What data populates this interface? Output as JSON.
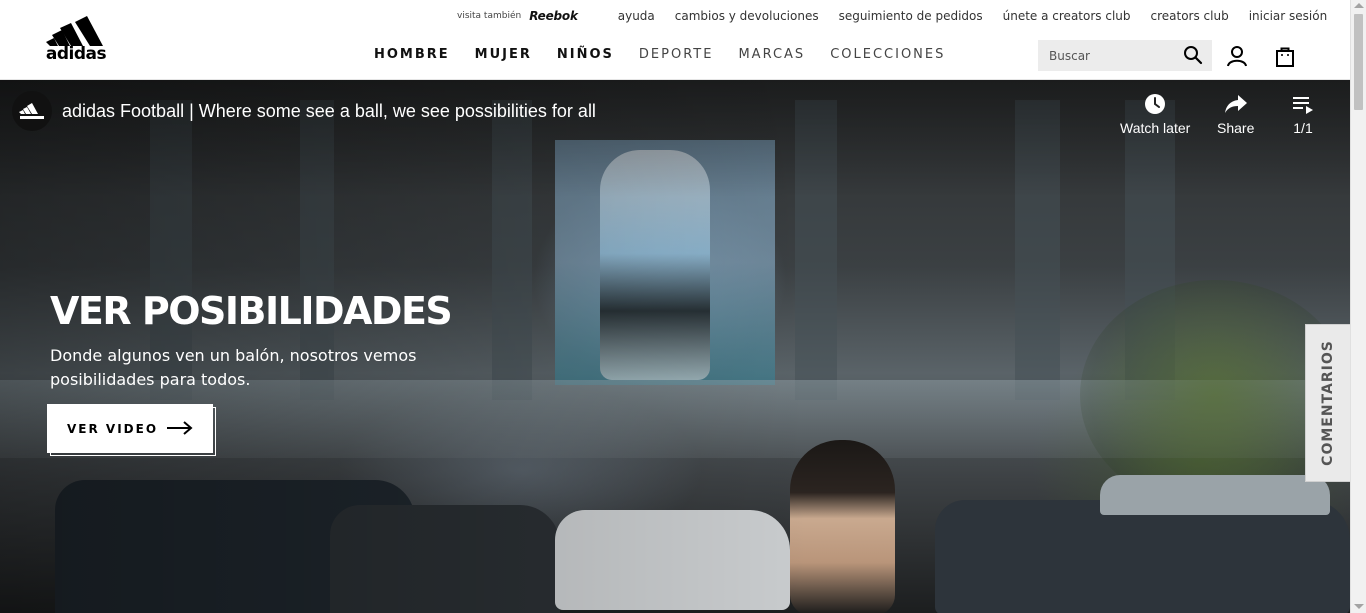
{
  "header": {
    "logo_text": "adidas",
    "visit_label": "visita también",
    "reebok_label": "Reebok",
    "util_links": [
      "ayuda",
      "cambios y devoluciones",
      "seguimiento de pedidos",
      "únete a creators club",
      "creators club",
      "iniciar sesión"
    ],
    "nav": [
      {
        "label": "HOMBRE",
        "weight": "strong"
      },
      {
        "label": "MUJER",
        "weight": "strong"
      },
      {
        "label": "NIÑOS",
        "weight": "strong"
      },
      {
        "label": "DEPORTE",
        "weight": "light"
      },
      {
        "label": "MARCAS",
        "weight": "light"
      },
      {
        "label": "COLECCIONES",
        "weight": "light"
      }
    ],
    "search_placeholder": "Buscar",
    "icons": [
      "search-icon",
      "user-icon",
      "bag-icon"
    ]
  },
  "video": {
    "title": "adidas Football | Where some see a ball, we see possibilities for all",
    "watch_later": "Watch later",
    "share": "Share",
    "playlist_count": "1/1"
  },
  "hero": {
    "title": "VER POSIBILIDADES",
    "subtitle": "Donde algunos ven un balón, nosotros vemos posibilidades para todos.",
    "cta": "VER VIDEO"
  },
  "comments_tab": "COMENTARIOS",
  "colors": {
    "brand": "#000000",
    "hero_text": "#ffffff",
    "search_bg": "#ececec"
  }
}
